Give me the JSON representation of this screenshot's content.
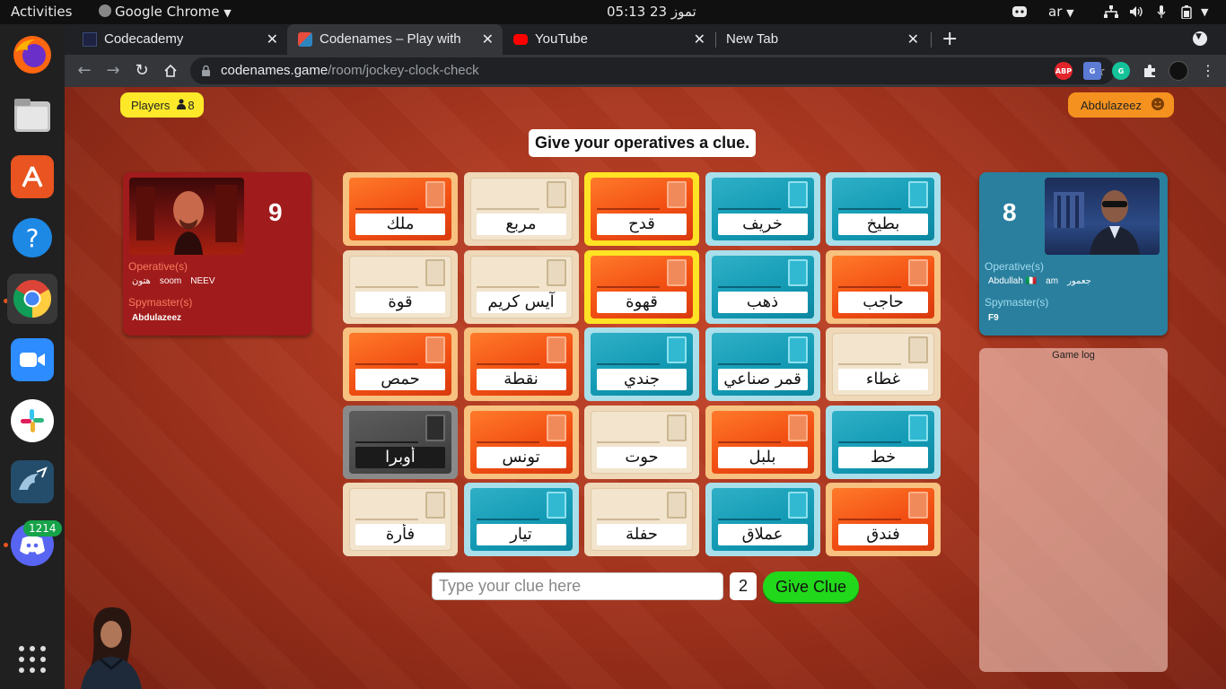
{
  "topbar": {
    "activities": "Activities",
    "app_name": "Google Chrome",
    "clock": "05:13  23 تموز",
    "keyboard_layout": "ar"
  },
  "dock": {
    "apps": [
      {
        "name": "Firefox",
        "icon": "firefox-icon"
      },
      {
        "name": "Files",
        "icon": "files-icon"
      },
      {
        "name": "Ubuntu Software",
        "icon": "software-center-icon"
      },
      {
        "name": "Help",
        "icon": "help-icon"
      },
      {
        "name": "Google Chrome",
        "icon": "chrome-icon"
      },
      {
        "name": "Zoom",
        "icon": "zoom-icon"
      },
      {
        "name": "Slack",
        "icon": "slack-icon"
      },
      {
        "name": "MySQL Workbench",
        "icon": "mysql-workbench-icon"
      },
      {
        "name": "Discord",
        "icon": "discord-icon"
      }
    ],
    "discord_badge": "1214"
  },
  "browser": {
    "tabs": [
      {
        "label": "Codecademy",
        "active": false
      },
      {
        "label": "Codenames – Play with yo",
        "active": true
      },
      {
        "label": "YouTube",
        "active": false
      },
      {
        "label": "New Tab",
        "active": false
      }
    ],
    "url_host": "codenames.game",
    "url_path": "/room/jockey-clock-check",
    "extensions": [
      "ABP",
      "Translate",
      "Grammarly",
      "Extensions",
      "Profile"
    ]
  },
  "game": {
    "players_label": "Players",
    "players_count": "8",
    "username": "Abdulazeez",
    "prompt": "Give your operatives a clue.",
    "red_team": {
      "score": "9",
      "operatives_label": "Operative(s)",
      "operatives": [
        "هتون",
        "soom",
        "NEEV"
      ],
      "spymasters_label": "Spymaster(s)",
      "spymasters": [
        "Abdulazeez"
      ],
      "color": "#a01b1b"
    },
    "blue_team": {
      "score": "8",
      "operatives_label": "Operative(s)",
      "operatives": [
        "Abdullah 🇮🇹",
        "am",
        "جعمور"
      ],
      "spymasters_label": "Spymaster(s)",
      "spymasters": [
        "F9"
      ],
      "color": "#2a7f9e"
    },
    "game_log_title": "Game log",
    "cards": [
      {
        "word": "ملك",
        "type": "red"
      },
      {
        "word": "مربع",
        "type": "neutral"
      },
      {
        "word": "قدح",
        "type": "red",
        "selected": true
      },
      {
        "word": "خريف",
        "type": "blue"
      },
      {
        "word": "بطيخ",
        "type": "blue"
      },
      {
        "word": "قوة",
        "type": "neutral"
      },
      {
        "word": "آيس كريم",
        "type": "neutral"
      },
      {
        "word": "قهوة",
        "type": "red",
        "selected": true
      },
      {
        "word": "ذهب",
        "type": "blue"
      },
      {
        "word": "حاجب",
        "type": "red"
      },
      {
        "word": "حمص",
        "type": "red"
      },
      {
        "word": "نقطة",
        "type": "red"
      },
      {
        "word": "جندي",
        "type": "blue"
      },
      {
        "word": "قمر صناعي",
        "type": "blue"
      },
      {
        "word": "غطاء",
        "type": "neutral"
      },
      {
        "word": "أوبرا",
        "type": "assassin"
      },
      {
        "word": "تونس",
        "type": "red"
      },
      {
        "word": "حوت",
        "type": "neutral"
      },
      {
        "word": "بلبل",
        "type": "red"
      },
      {
        "word": "خط",
        "type": "blue"
      },
      {
        "word": "فأرة",
        "type": "neutral"
      },
      {
        "word": "تيار",
        "type": "blue"
      },
      {
        "word": "حفلة",
        "type": "neutral"
      },
      {
        "word": "عملاق",
        "type": "blue"
      },
      {
        "word": "فندق",
        "type": "red"
      }
    ],
    "clue_placeholder": "Type your clue here",
    "clue_count": "2",
    "give_clue_label": "Give Clue"
  }
}
